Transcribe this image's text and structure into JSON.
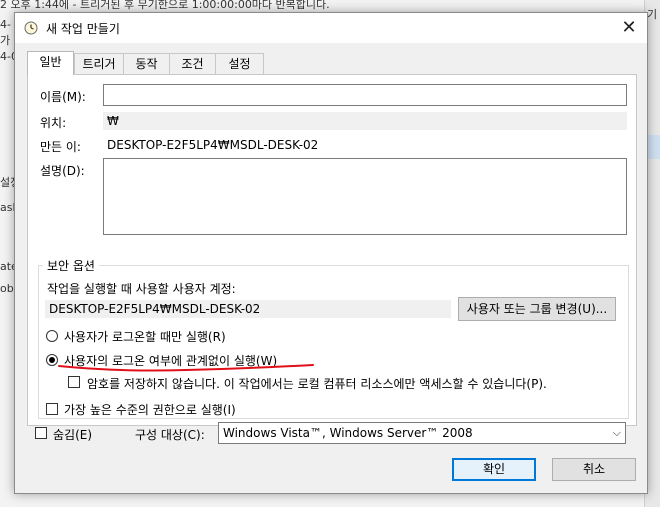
{
  "background": {
    "top_text": "2 오후 1:44에 - 트리거된 후 무기한으로 1:00:00:00마다 반복합니다.",
    "left_fragments": [
      "4-",
      "가 트",
      "4-0",
      "설정",
      "ask",
      "ate",
      "obe"
    ],
    "right_fragment": "기"
  },
  "window": {
    "title": "새 작업 만들기",
    "close_symbol": "✕"
  },
  "tabs": [
    {
      "label": "일반",
      "active": true
    },
    {
      "label": "트리거",
      "active": false
    },
    {
      "label": "동작",
      "active": false
    },
    {
      "label": "조건",
      "active": false
    },
    {
      "label": "설정",
      "active": false
    }
  ],
  "general": {
    "name_label": "이름(M):",
    "name_value": "",
    "location_label": "위치:",
    "location_value": "₩",
    "author_label": "만든 이:",
    "author_value": "DESKTOP-E2F5LP4₩MSDL-DESK-02",
    "description_label": "설명(D):",
    "description_value": ""
  },
  "security": {
    "group_title": "보안 옵션",
    "account_prompt": "작업을 실행할 때 사용할 사용자 계정:",
    "account_value": "DESKTOP-E2F5LP4₩MSDL-DESK-02",
    "change_button": "사용자 또는 그룹 변경(U)...",
    "radio_logged_on": "사용자가 로그온할 때만 실행(R)",
    "radio_whether_logged": "사용자의 로그온 여부에 관계없이 실행(W)",
    "selected_radio": "whether_logged",
    "no_store_password": "암호를 저장하지 않습니다. 이 작업에서는 로컬 컴퓨터 리소스에만 액세스할 수 있습니다(P).",
    "highest_privileges": "가장 높은 수준의 권한으로 실행(I)"
  },
  "bottom": {
    "hidden_label": "숨김(E)",
    "configure_label": "구성 대상(C):",
    "configure_value": "Windows Vista™, Windows Server™ 2008",
    "ok": "확인",
    "cancel": "취소"
  },
  "colors": {
    "annotation_red": "#e0101a",
    "primary_border": "#0078d7"
  },
  "icons": {
    "title": "clock-icon",
    "dropdown": "chevron-down-icon"
  }
}
